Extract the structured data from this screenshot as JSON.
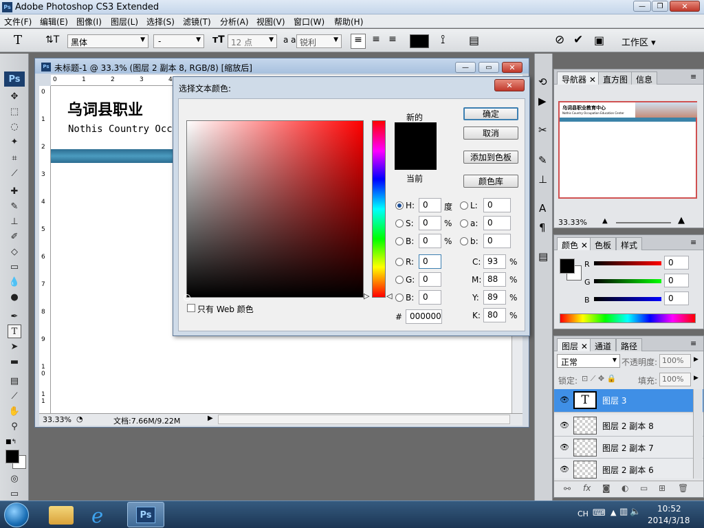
{
  "app": {
    "title": "Adobe Photoshop CS3 Extended",
    "icon": "Ps"
  },
  "menu": [
    "文件(F)",
    "编辑(E)",
    "图像(I)",
    "图层(L)",
    "选择(S)",
    "滤镜(T)",
    "分析(A)",
    "视图(V)",
    "窗口(W)",
    "帮助(H)"
  ],
  "options": {
    "font_family": "黑体",
    "font_style": "-",
    "font_size": "12 点",
    "aa_label": "a a",
    "antialias": "锐利",
    "workspace": "工作区"
  },
  "document": {
    "title": "未标题-1 @ 33.3% (图层 2 副本 8, RGB/8) [缩放后]",
    "heading": "乌词县职业",
    "subheading": "Nothis Country Occ",
    "zoom": "33.33%",
    "doc_size": "文档:7.66M/9.22M",
    "ruler_h": [
      "0",
      "1",
      "2",
      "3",
      "4"
    ],
    "ruler_v": [
      "0",
      "1",
      "2",
      "3",
      "4",
      "5",
      "6",
      "7",
      "8",
      "9",
      "1 0",
      "1 1"
    ]
  },
  "dialog": {
    "title": "选择文本颜色:",
    "new_label": "新的",
    "current_label": "当前",
    "buttons": {
      "ok": "确定",
      "cancel": "取消",
      "add_swatch": "添加到色板",
      "libraries": "颜色库"
    },
    "web_only": "只有 Web 颜色",
    "hsb": [
      {
        "label": "H:",
        "value": "0",
        "unit": "度"
      },
      {
        "label": "S:",
        "value": "0",
        "unit": "%"
      },
      {
        "label": "B:",
        "value": "0",
        "unit": "%"
      }
    ],
    "lab": [
      {
        "label": "L:",
        "value": "0"
      },
      {
        "label": "a:",
        "value": "0"
      },
      {
        "label": "b:",
        "value": "0"
      }
    ],
    "rgb": [
      {
        "label": "R:",
        "value": "0"
      },
      {
        "label": "G:",
        "value": "0"
      },
      {
        "label": "B:",
        "value": "0"
      }
    ],
    "cmyk": [
      {
        "label": "C:",
        "value": "93",
        "unit": "%"
      },
      {
        "label": "M:",
        "value": "88",
        "unit": "%"
      },
      {
        "label": "Y:",
        "value": "89",
        "unit": "%"
      },
      {
        "label": "K:",
        "value": "80",
        "unit": "%"
      }
    ],
    "hex_label": "#",
    "hex": "000000",
    "colors": {
      "new": "#000000",
      "current": "#000000",
      "hue": "#ff0000"
    }
  },
  "navigator": {
    "tabs": [
      "导航器",
      "直方图",
      "信息"
    ],
    "zoom": "33.33%",
    "preview_title": "乌词县职业教育中心",
    "preview_sub": "Nothis Country Occupation Education Center"
  },
  "color_panel": {
    "tabs": [
      "颜色",
      "色板",
      "样式"
    ],
    "sliders": [
      {
        "label": "R",
        "value": "0",
        "color": "#c00000"
      },
      {
        "label": "G",
        "value": "0",
        "color": "#00a000"
      },
      {
        "label": "B",
        "value": "0",
        "color": "#0000c0"
      }
    ]
  },
  "layers": {
    "tabs": [
      "图层",
      "通道",
      "路径"
    ],
    "blend_mode": "正常",
    "opacity_label": "不透明度:",
    "opacity": "100%",
    "lock_label": "锁定:",
    "fill_label": "填充:",
    "fill": "100%",
    "items": [
      {
        "name": "图层 3",
        "type": "text"
      },
      {
        "name": "图层 2 副本 8",
        "type": "raster"
      },
      {
        "name": "图层 2 副本 7",
        "type": "raster"
      },
      {
        "name": "图层 2 副本 6",
        "type": "raster"
      }
    ]
  },
  "taskbar": {
    "lang": "CH",
    "time": "10:52",
    "date": "2014/3/18"
  }
}
